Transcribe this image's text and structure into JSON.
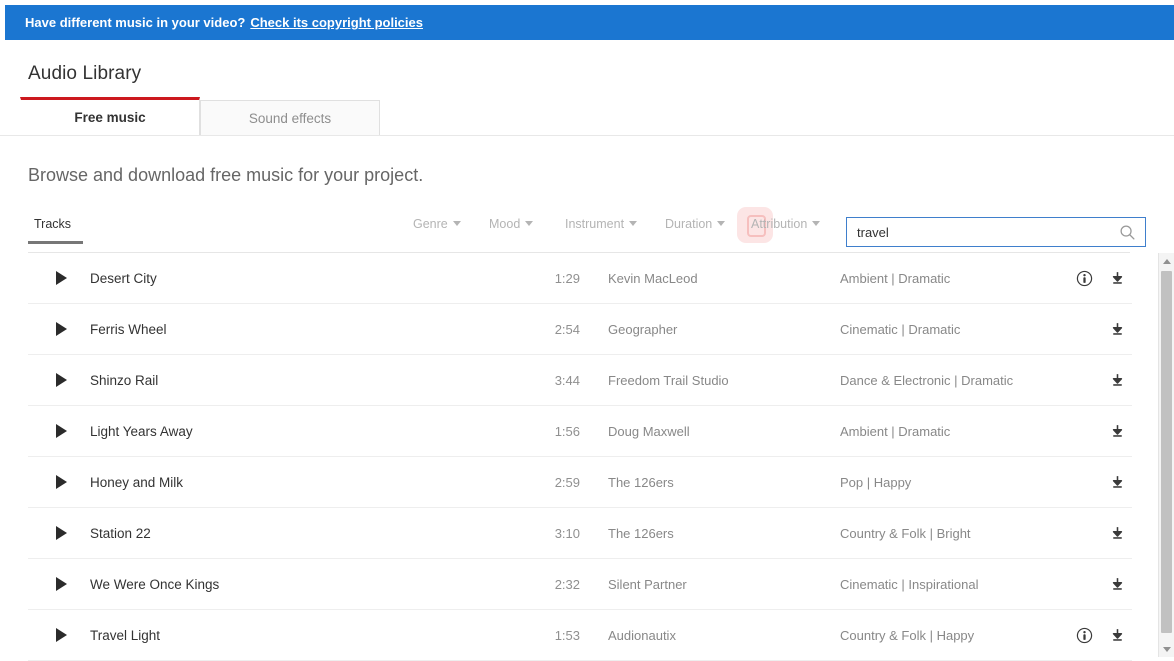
{
  "banner": {
    "text": "Have different music in your video?",
    "link_label": "Check its copyright policies"
  },
  "page_title": "Audio Library",
  "tabs": [
    {
      "label": "Free music",
      "active": true
    },
    {
      "label": "Sound effects",
      "active": false
    }
  ],
  "subtitle": "Browse and download free music for your project.",
  "filters": {
    "tracks_label": "Tracks",
    "items": [
      {
        "label": "Genre"
      },
      {
        "label": "Mood"
      },
      {
        "label": "Instrument"
      },
      {
        "label": "Duration"
      },
      {
        "label": "Attribution"
      }
    ]
  },
  "search": {
    "value": "travel",
    "placeholder": "",
    "icon": "search-icon"
  },
  "table": {
    "rows": [
      {
        "title": "Desert City",
        "duration": "1:29",
        "artist": "Kevin MacLeod",
        "genre": "Ambient | Dramatic",
        "attribution": true
      },
      {
        "title": "Ferris Wheel",
        "duration": "2:54",
        "artist": "Geographer",
        "genre": "Cinematic | Dramatic",
        "attribution": false
      },
      {
        "title": "Shinzo Rail",
        "duration": "3:44",
        "artist": "Freedom Trail Studio",
        "genre": "Dance & Electronic | Dramatic",
        "attribution": false
      },
      {
        "title": "Light Years Away",
        "duration": "1:56",
        "artist": "Doug Maxwell",
        "genre": "Ambient | Dramatic",
        "attribution": false
      },
      {
        "title": "Honey and Milk",
        "duration": "2:59",
        "artist": "The 126ers",
        "genre": "Pop | Happy",
        "attribution": false
      },
      {
        "title": "Station 22",
        "duration": "3:10",
        "artist": "The 126ers",
        "genre": "Country & Folk | Bright",
        "attribution": false
      },
      {
        "title": "We Were Once Kings",
        "duration": "2:32",
        "artist": "Silent Partner",
        "genre": "Cinematic | Inspirational",
        "attribution": false
      },
      {
        "title": "Travel Light",
        "duration": "1:53",
        "artist": "Audionautix",
        "genre": "Country & Folk | Happy",
        "attribution": true
      }
    ]
  },
  "colors": {
    "banner_blue": "#1b76d1",
    "tab_accent_red": "#cc181e",
    "search_border": "#3f7fcc",
    "click_highlight": "#e53935"
  }
}
